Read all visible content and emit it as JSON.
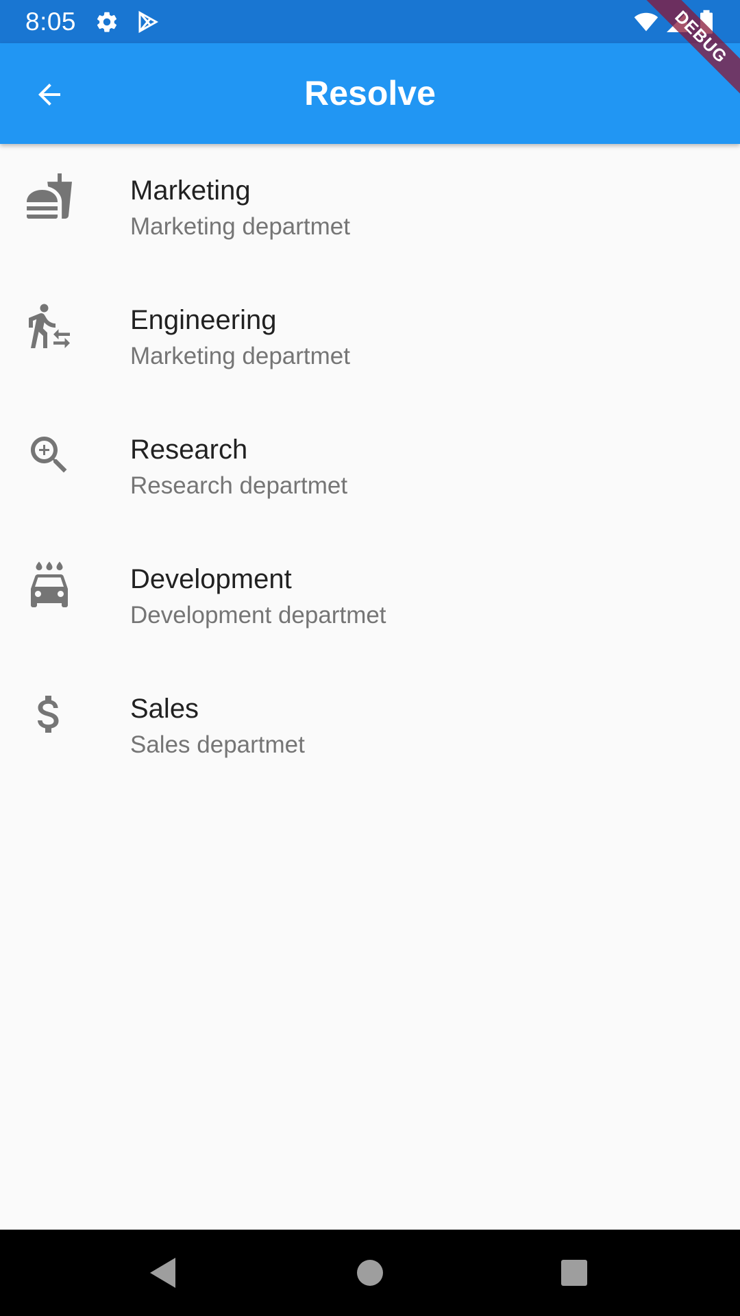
{
  "status_bar": {
    "time": "8:05",
    "icons": [
      "settings-icon",
      "play-store-icon",
      "wifi-icon",
      "signal-icon",
      "battery-icon"
    ],
    "background": "#1976d2"
  },
  "app_bar": {
    "title": "Resolve",
    "back_icon": "arrow-back-icon",
    "background": "#2196f3"
  },
  "debug_banner": {
    "label": "DEBUG"
  },
  "departments": [
    {
      "icon": "fastfood-icon",
      "title": "Marketing",
      "subtitle": "Marketing departmet"
    },
    {
      "icon": "transfer-within-station-icon",
      "title": "Engineering",
      "subtitle": "Marketing departmet"
    },
    {
      "icon": "zoom-in-icon",
      "title": "Research",
      "subtitle": "Research departmet"
    },
    {
      "icon": "local-car-wash-icon",
      "title": "Development",
      "subtitle": "Development departmet"
    },
    {
      "icon": "attach-money-icon",
      "title": "Sales",
      "subtitle": "Sales departmet"
    }
  ],
  "nav_bar": {
    "buttons": [
      "back-icon",
      "home-icon",
      "recents-icon"
    ]
  },
  "colors": {
    "icon_gray": "#757575",
    "title_text": "#212121",
    "subtitle_text": "#757575",
    "page_background": "#fafafa"
  }
}
